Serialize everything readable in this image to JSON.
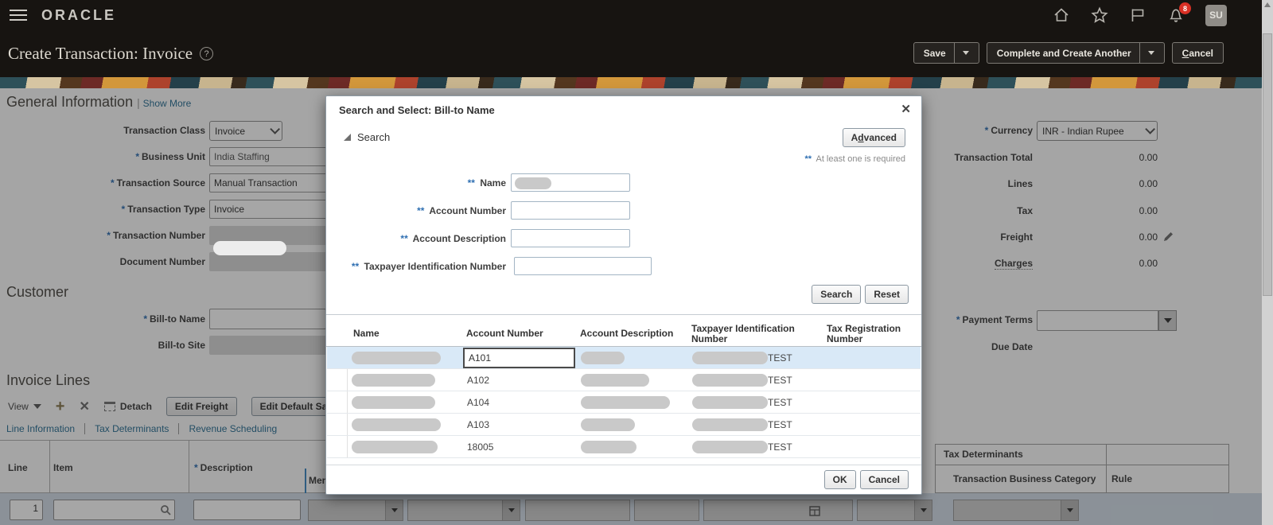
{
  "colors": {
    "badge_red": "#d93025",
    "link_blue": "#2d7196",
    "required_blue": "#2f6fb2",
    "selected_row": "#d9e9f7"
  },
  "topbar": {
    "logo": "ORACLE",
    "avatar": "SU",
    "notification_count": "8"
  },
  "title": {
    "text": "Create Transaction: Invoice",
    "help": "?"
  },
  "actions": {
    "save": "Save",
    "complete": "Complete and Create Another",
    "cancel_initial": "C",
    "cancel_rest": "ancel"
  },
  "general": {
    "heading": "General Information",
    "show_more": "Show More",
    "labels": {
      "transaction_class": "Transaction Class",
      "business_unit": "Business Unit",
      "transaction_source": "Transaction Source",
      "transaction_type": "Transaction Type",
      "transaction_number": "Transaction Number",
      "document_number": "Document Number"
    },
    "values": {
      "transaction_class": "Invoice",
      "business_unit": "India Staffing",
      "transaction_source": "Manual Transaction",
      "transaction_type": "Invoice"
    }
  },
  "customer": {
    "heading": "Customer",
    "bill_to_name": "Bill-to Name",
    "bill_to_site": "Bill-to Site"
  },
  "totals": {
    "currency_label": "Currency",
    "currency_value": "INR - Indian Rupee",
    "transaction_total_label": "Transaction Total",
    "transaction_total": "0.00",
    "lines_label": "Lines",
    "lines": "0.00",
    "tax_label": "Tax",
    "tax": "0.00",
    "freight_label": "Freight",
    "freight": "0.00",
    "charges_label": "Charges",
    "charges": "0.00",
    "payment_terms_label": "Payment Terms",
    "due_date_label": "Due Date"
  },
  "invoice_lines": {
    "heading": "Invoice Lines",
    "view": "View",
    "detach": "Detach",
    "edit_freight": "Edit Freight",
    "edit_default_sales": "Edit Default Sales C",
    "tabs": {
      "t1": "Line Information",
      "t2": "Tax Determinants",
      "t3": "Revenue Scheduling"
    },
    "columns": {
      "line": "Line",
      "item": "Item",
      "description": "Description",
      "memo": "Mem"
    },
    "first_line_number": "1"
  },
  "tax_determinants": {
    "heading": "Tax Determinants",
    "col_category": "Transaction Business Category",
    "col_rule": "Rule"
  },
  "modal": {
    "title": "Search and Select: Bill-to Name",
    "close": "✕",
    "search_section": "Search",
    "advanced_pre": "A",
    "advanced_key": "d",
    "advanced_rest": "vanced",
    "note_stars": "**",
    "note_text": " At least one is required",
    "field_req": "**",
    "fields": {
      "name": "Name",
      "account_number": "Account Number",
      "account_description": "Account Description",
      "taxpayer_id": "Taxpayer Identification Number"
    },
    "buttons": {
      "search": "Search",
      "reset": "Reset",
      "ok": "OK",
      "cancel": "Cancel"
    },
    "results": {
      "columns": {
        "name": "Name",
        "account_number": "Account Number",
        "account_description": "Account Description",
        "taxpayer_id": "Taxpayer Identification Number",
        "tax_registration": "Tax Registration Number"
      },
      "rows": [
        {
          "account_number": "A101",
          "tin_text": "TEST"
        },
        {
          "account_number": "A102",
          "tin_text": "TEST"
        },
        {
          "account_number": "A104",
          "tin_text": "TEST"
        },
        {
          "account_number": "A103",
          "tin_text": "TEST"
        },
        {
          "account_number": "18005",
          "tin_text": "TEST"
        }
      ]
    }
  }
}
